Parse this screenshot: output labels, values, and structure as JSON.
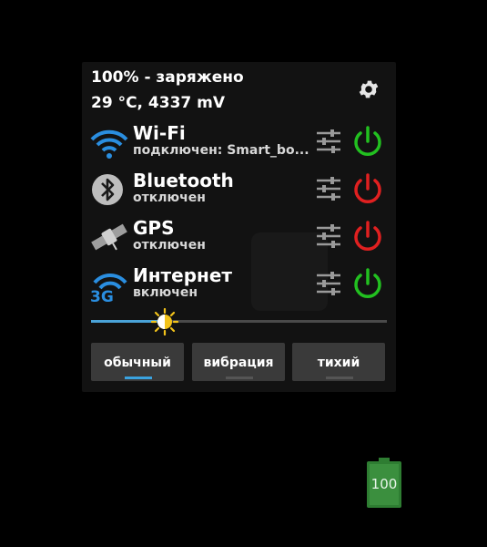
{
  "status": {
    "battery_text": "100% - заряжено",
    "temp_text": "29 °C, 4337 mV"
  },
  "toggles": [
    {
      "name": "Wi-Fi",
      "state": "подключен: Smart_bo...",
      "icon": "wifi-icon",
      "power_color": "#22c020",
      "on": true
    },
    {
      "name": "Bluetooth",
      "state": "отключен",
      "icon": "bluetooth-icon",
      "power_color": "#e02020",
      "on": false
    },
    {
      "name": "GPS",
      "state": "отключен",
      "icon": "satellite-icon",
      "power_color": "#e02020",
      "on": false
    },
    {
      "name": "Интернет",
      "state": "включен",
      "icon": "mobile-data-3g-icon",
      "icon_text": "3G",
      "power_color": "#22c020",
      "on": true
    }
  ],
  "brightness": {
    "level": 0.25,
    "icon": "brightness-sun-icon"
  },
  "sound_modes": [
    {
      "label": "обычный",
      "active": true
    },
    {
      "label": "вибрация",
      "active": false
    },
    {
      "label": "тихий",
      "active": false
    }
  ],
  "battery_icon": {
    "value": "100",
    "color": "#2e7d32"
  },
  "colors": {
    "accent": "#3aa3e0",
    "on": "#22c020",
    "off": "#e02020"
  }
}
